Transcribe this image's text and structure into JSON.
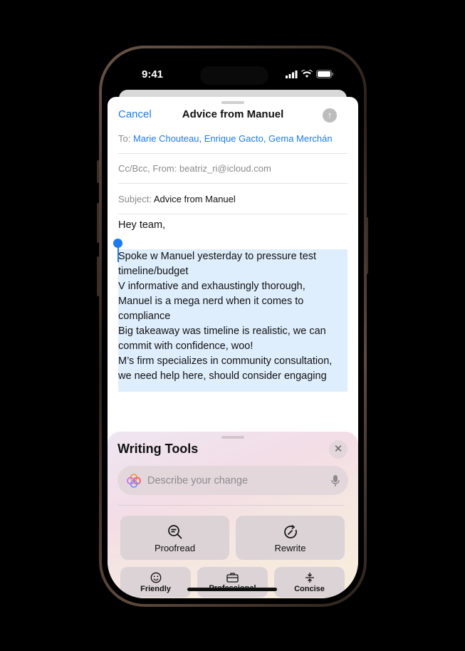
{
  "status": {
    "time": "9:41"
  },
  "compose": {
    "cancel": "Cancel",
    "title": "Advice from Manuel",
    "to_label": "To:",
    "to_value": "Marie Chouteau, Enrique Gacto, Gema Merchán",
    "ccbcc_label": "Cc/Bcc, From:",
    "from_value": "beatriz_ri@icloud.com",
    "subject_label": "Subject:",
    "subject_value": "Advice from Manuel",
    "greeting": "Hey team,",
    "selected_lines": [
      "Spoke w Manuel yesterday to pressure test",
      "timeline/budget",
      "V informative and exhaustingly thorough,",
      "Manuel is a mega nerd when it comes to",
      "compliance",
      "Big takeaway was timeline is realistic, we can",
      "commit with confidence, woo!",
      "M’s firm specializes in community consultation,",
      "we need help here, should consider engaging"
    ]
  },
  "writing_tools": {
    "title": "Writing Tools",
    "placeholder": "Describe your change",
    "tools": [
      {
        "label": "Proofread",
        "icon": "magnifier-text-icon"
      },
      {
        "label": "Rewrite",
        "icon": "rewrite-circle-icon"
      },
      {
        "label": "Friendly",
        "icon": "smiley-icon"
      },
      {
        "label": "Professional",
        "icon": "briefcase-icon"
      },
      {
        "label": "Concise",
        "icon": "compress-icon"
      }
    ]
  },
  "colors": {
    "accent": "#1a7cf5",
    "selection": "#dfeefd"
  }
}
